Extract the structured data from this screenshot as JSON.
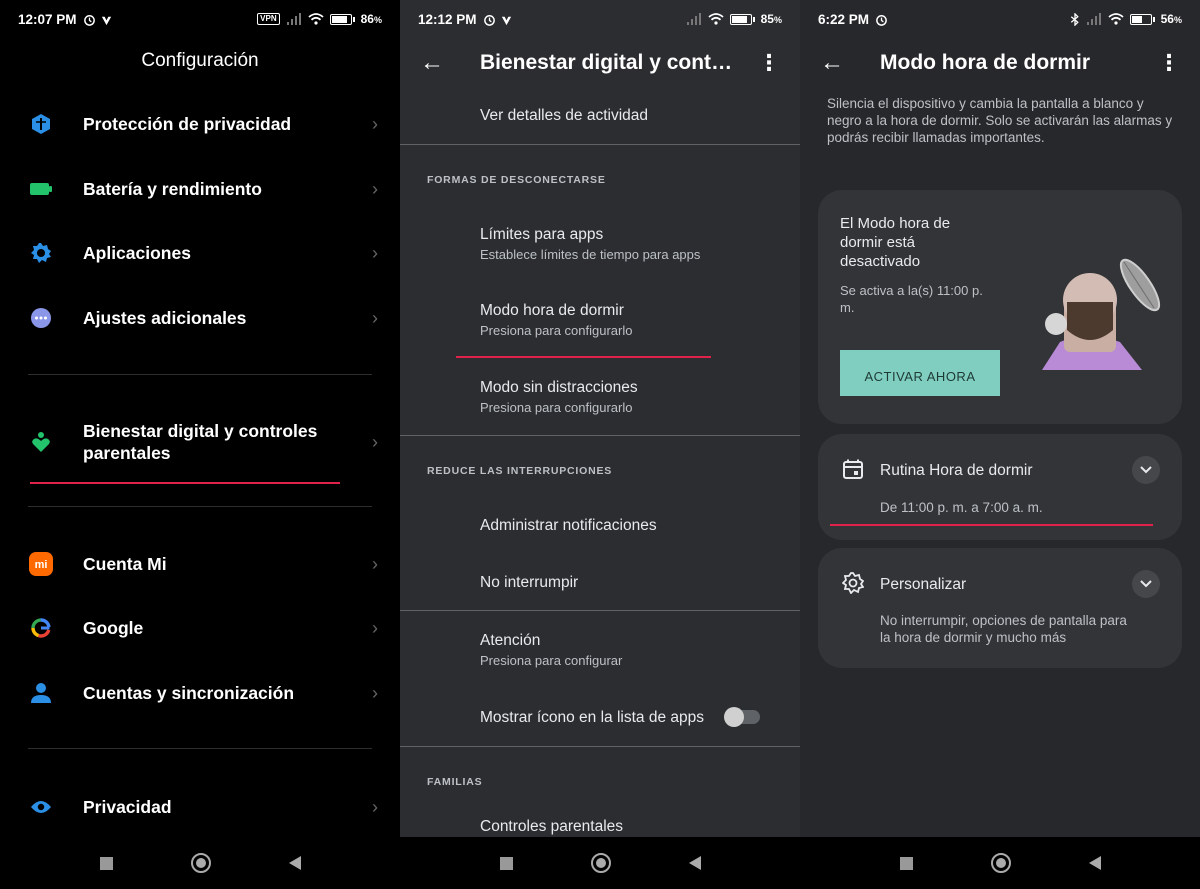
{
  "screen1": {
    "status": {
      "time": "12:07 PM",
      "battery": "86",
      "battery_unit": "%",
      "vpn": "VPN"
    },
    "title": "Configuración",
    "items": [
      {
        "label": "Protección de privacidad",
        "icon": "shield-icon",
        "color": "#2b8fe6"
      },
      {
        "label": "Batería y rendimiento",
        "icon": "battery-icon",
        "color": "#22c36a"
      },
      {
        "label": "Aplicaciones",
        "icon": "gear-icon",
        "color": "#2b8fe6"
      },
      {
        "label": "Ajustes adicionales",
        "icon": "more-dots-icon",
        "color": "#8a97e8"
      },
      {
        "label": "Bienestar digital y controles parentales",
        "icon": "wellbeing-icon",
        "color": "#22c36a"
      },
      {
        "label": "Cuenta Mi",
        "icon": "mi-logo-icon",
        "color": "#ff6a00"
      },
      {
        "label": "Google",
        "icon": "google-icon",
        "color": "#4285f4"
      },
      {
        "label": "Cuentas y sincronización",
        "icon": "account-icon",
        "color": "#2b8fe6"
      },
      {
        "label": "Privacidad",
        "icon": "eye-icon",
        "color": "#2b8fe6"
      }
    ],
    "mi_text": "mi",
    "google_text": "G"
  },
  "screen2": {
    "status": {
      "time": "12:12 PM",
      "battery": "85",
      "battery_unit": "%"
    },
    "title": "Bienestar digital y contr…",
    "activity": "Ver detalles de actividad",
    "section_disconnect": "FORMAS DE DESCONECTARSE",
    "app_limits": {
      "title": "Límites para apps",
      "subtitle": "Establece límites de tiempo para apps"
    },
    "bedtime": {
      "title": "Modo hora de dormir",
      "subtitle": "Presiona para configurarlo"
    },
    "focus": {
      "title": "Modo sin distracciones",
      "subtitle": "Presiona para configurarlo"
    },
    "section_interruptions": "REDUCE LAS INTERRUPCIONES",
    "notifications": "Administrar notificaciones",
    "dnd": "No interrumpir",
    "heads_up": {
      "title": "Atención",
      "subtitle": "Presiona para configurar"
    },
    "show_icon": {
      "title": "Mostrar ícono en la lista de apps",
      "enabled": false
    },
    "section_families": "FAMILIAS",
    "parental": "Controles parentales"
  },
  "screen3": {
    "status": {
      "time": "6:22 PM",
      "battery": "56",
      "battery_unit": "%"
    },
    "title": "Modo hora de dormir",
    "description": "Silencia el dispositivo y cambia la pantalla a blanco y negro a la hora de dormir. Solo se activarán las alarmas y podrás recibir llamadas importantes.",
    "status_card": {
      "title": "El Modo hora de dormir está desactivado",
      "subtitle": "Se activa a la(s) 11:00 p. m.",
      "button": "ACTIVAR AHORA"
    },
    "routine": {
      "title": "Rutina Hora de dormir",
      "subtitle": "De 11:00 p. m. a 7:00 a. m."
    },
    "customize": {
      "title": "Personalizar",
      "subtitle": "No interrumpir, opciones de pantalla para la hora de dormir y mucho más"
    }
  },
  "colors": {
    "highlight": "#e0214a",
    "accent": "#7fcec0"
  }
}
